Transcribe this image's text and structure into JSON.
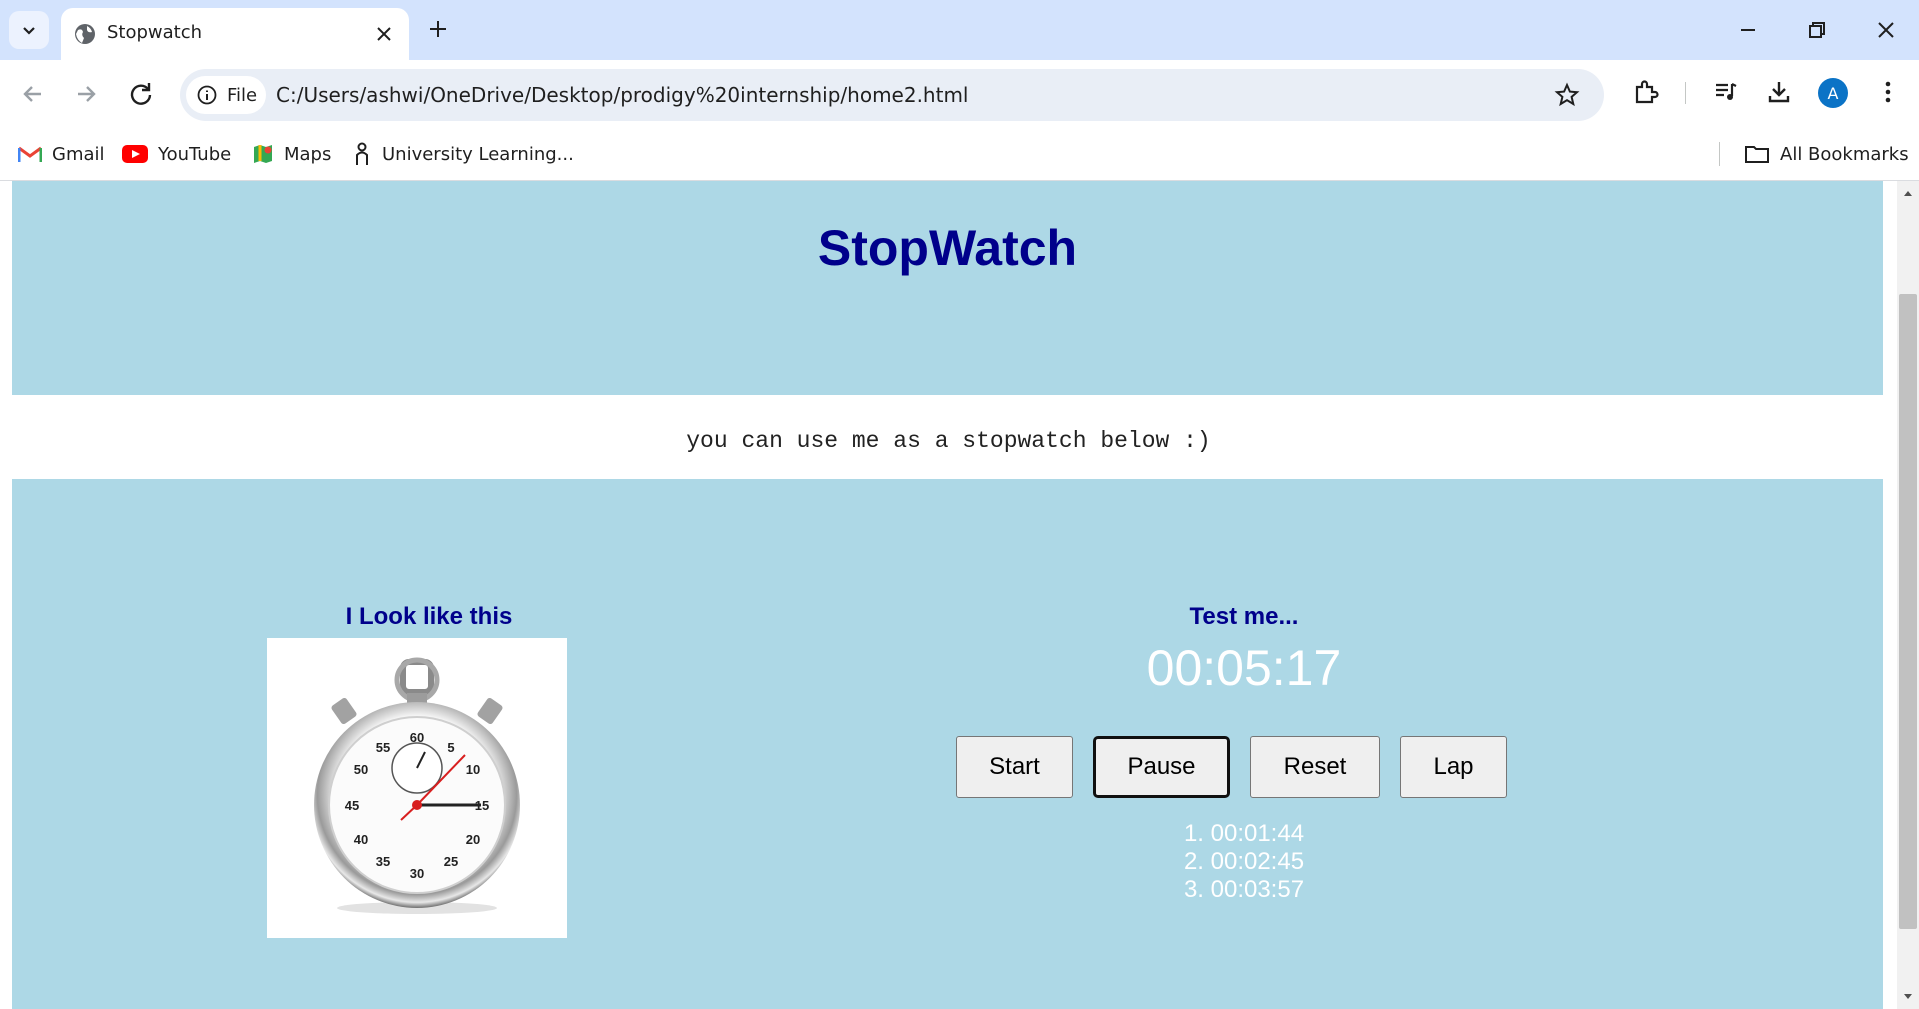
{
  "browser": {
    "tab_title": "Stopwatch",
    "file_chip_label": "File",
    "url": "C:/Users/ashwi/OneDrive/Desktop/prodigy%20internship/home2.html",
    "profile_initial": "A",
    "bookmarks": [
      {
        "label": "Gmail",
        "icon": "gmail-icon"
      },
      {
        "label": "YouTube",
        "icon": "youtube-icon"
      },
      {
        "label": "Maps",
        "icon": "maps-icon"
      },
      {
        "label": "University Learning...",
        "icon": "university-icon"
      }
    ],
    "all_bookmarks_label": "All Bookmarks",
    "colors": {
      "tabstrip": "#d3e3fd",
      "omnibox": "#e9eef6",
      "profile": "#0b73c6"
    }
  },
  "page": {
    "title": "StopWatch",
    "tagline": "you can use me as a stopwatch below :)",
    "look_heading": "I Look like this",
    "test_heading": "Test me...",
    "display": "00:05:17",
    "buttons": {
      "start": "Start",
      "pause": "Pause",
      "reset": "Reset",
      "lap": "Lap"
    },
    "laps": [
      "1. 00:01:44",
      "2. 00:02:45",
      "3. 00:03:57"
    ],
    "image_dial_numbers": [
      "60",
      "5",
      "10",
      "15",
      "20",
      "25",
      "30",
      "35",
      "40",
      "45",
      "50",
      "55"
    ],
    "colors": {
      "panel": "#add8e6",
      "heading": "#00008b",
      "display": "#ffffff"
    }
  }
}
